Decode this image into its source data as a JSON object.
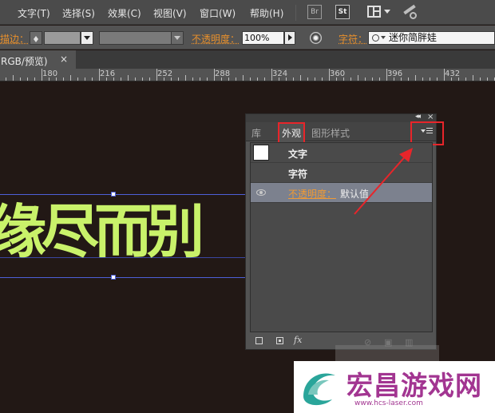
{
  "menubar": {
    "items": [
      "文字(T)",
      "选择(S)",
      "效果(C)",
      "视图(V)",
      "窗口(W)",
      "帮助(H)"
    ],
    "icons": [
      "bridge-icon",
      "stock-icon",
      "arrange-documents-icon",
      "gpu-performance-icon"
    ],
    "bridge_label": "Br",
    "stock_label": "St"
  },
  "controlbar": {
    "stroke_label": "描边：",
    "opacity_label": "不透明度：",
    "opacity_value": "100%",
    "char_label": "字符：",
    "font_value": "迷你简胖娃"
  },
  "document": {
    "tab_label": "RGB/预览)",
    "close": "×"
  },
  "ruler": {
    "labels": [
      "180",
      "216",
      "252",
      "288",
      "324",
      "360",
      "396",
      "432"
    ]
  },
  "canvas": {
    "text": "缘尽而别",
    "text_color": "#c9f26a",
    "background": "#221815",
    "selection_color": "#4d5fd8"
  },
  "appearance_panel": {
    "collapse": "◂◂",
    "close": "×",
    "tabs": [
      "库",
      "外观",
      "图形样式"
    ],
    "active_tab": "外观",
    "rows": {
      "text_row": "文字",
      "char_row": "字符",
      "opacity_label": "不透明度：",
      "opacity_value": "默认值"
    },
    "footer": {
      "fx": "fx"
    }
  },
  "annotation": {
    "color": "#e8252a"
  },
  "watermark": {
    "title": "宏昌游戏网",
    "url": "www.hcs-laser.com"
  }
}
